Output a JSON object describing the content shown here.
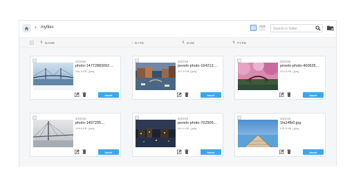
{
  "breadcrumb": {
    "current": "myfiles"
  },
  "search": {
    "placeholder": "Search in folder"
  },
  "columns": {
    "name": "NAME",
    "date": "DATE",
    "size": "SIZE",
    "type": "TYPE"
  },
  "icons": {
    "home": "home-icon",
    "breadcrumb_separator": "chevron-right-icon",
    "grid_view": "grid-view-icon",
    "list_view": "list-view-icon",
    "search": "search-icon",
    "new_folder": "new-folder-icon",
    "edit": "edit-icon",
    "delete": "trash-icon"
  },
  "colors": {
    "accent": "#3ea6e8",
    "grid_bg": "#f5f6f8"
  },
  "files": [
    {
      "date": "3/22/18",
      "name": "photo-14772883092…",
      "size": "281.5 KB",
      "type": "jpeg",
      "insert_label": "Insert"
    },
    {
      "date": "3/22/18",
      "name": "pexels-photo-164212…",
      "size": "407.6 KB",
      "type": "jpeg",
      "insert_label": "Insert"
    },
    {
      "date": "3/22/18",
      "name": "pexels-photo-460635…",
      "size": "429.5 KB",
      "type": "jpeg",
      "insert_label": "Insert"
    },
    {
      "date": "3/22/18",
      "name": "photo-1497295…",
      "size": "199.6 KB",
      "type": "jpeg",
      "insert_label": "Insert"
    },
    {
      "date": "3/22/18",
      "name": "pexels-photo-762905…",
      "size": "300.0 KB",
      "type": "jpeg",
      "insert_label": "Insert"
    },
    {
      "date": "3/22/18",
      "name": "1fa14fb0.jpg",
      "size": "231.9 KB",
      "type": "jpeg",
      "insert_label": "Insert"
    }
  ]
}
